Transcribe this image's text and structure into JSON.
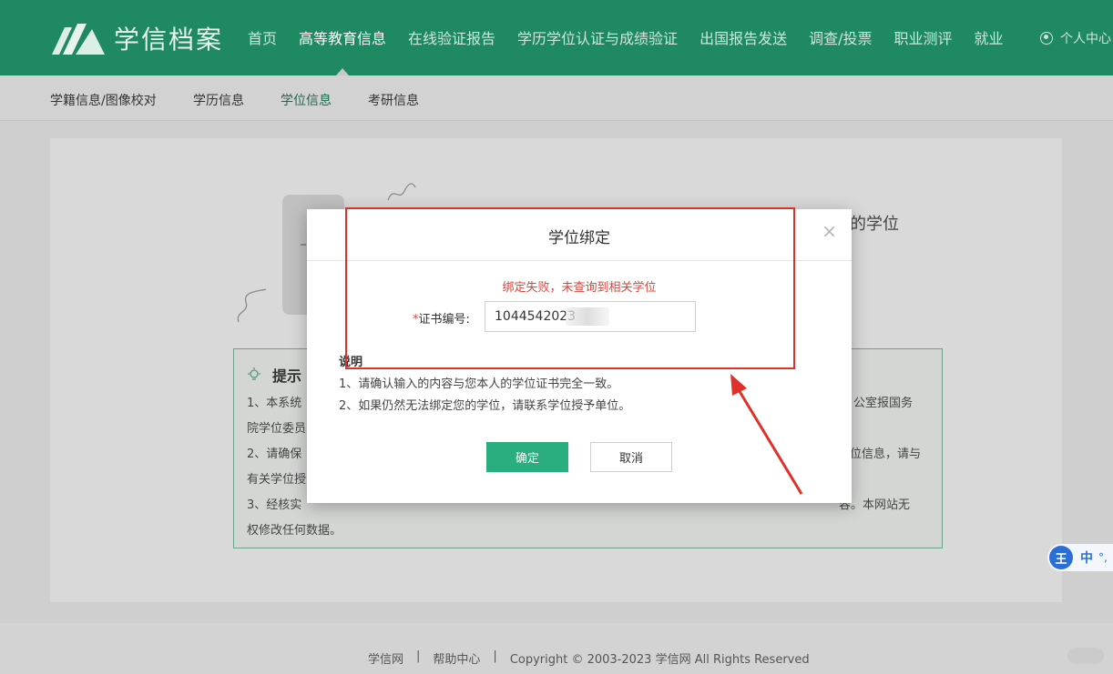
{
  "brand": {
    "name": "学信档案"
  },
  "nav": {
    "items": [
      {
        "label": "首页",
        "active": false
      },
      {
        "label": "高等教育信息",
        "active": true
      },
      {
        "label": "在线验证报告",
        "active": false
      },
      {
        "label": "学历学位认证与成绩验证",
        "active": false
      },
      {
        "label": "出国报告发送",
        "active": false
      },
      {
        "label": "调查/投票",
        "active": false
      },
      {
        "label": "职业测评",
        "active": false
      },
      {
        "label": "就业",
        "active": false
      }
    ],
    "user_label": "个人中心"
  },
  "subnav": {
    "items": [
      {
        "label": "学籍信息/图像校对",
        "active": false
      },
      {
        "label": "学历信息",
        "active": false
      },
      {
        "label": "学位信息",
        "active": true
      },
      {
        "label": "考研信息",
        "active": false
      }
    ]
  },
  "background": {
    "title_fragment": "的学位",
    "tip_title": "提示",
    "tip_lines": [
      "1、本系统",
      "公室报国务",
      "院学位委员",
      "2、请确保",
      "位信息，请与",
      "有关学位授",
      "3、经核实",
      "容。本网站无",
      "权修改任何数据。"
    ]
  },
  "modal": {
    "title": "学位绑定",
    "close_glyph": "×",
    "error_message": "绑定失败，未查询到相关学位",
    "field_required_mark": "*",
    "field_label": "证书编号:",
    "field_value": "1044542023",
    "note_title": "说明",
    "notes": [
      "1、请确认输入的内容与您本人的学位证书完全一致。",
      "2、如果仍然无法绑定您的学位，请联系学位授予单位。"
    ],
    "confirm_label": "确定",
    "cancel_label": "取消"
  },
  "footer": {
    "links": [
      "学信网",
      "|",
      "帮助中心",
      "|",
      "Copyright © 2003-2023 学信网 All Rights Reserved"
    ]
  },
  "ime": {
    "badge": "王",
    "mode": "中",
    "punct": "°,"
  },
  "colors": {
    "brand_green": "#1f8a62",
    "confirm_green": "#2aae7f",
    "error_red": "#d9453a",
    "annotation_red": "#e0302a"
  }
}
